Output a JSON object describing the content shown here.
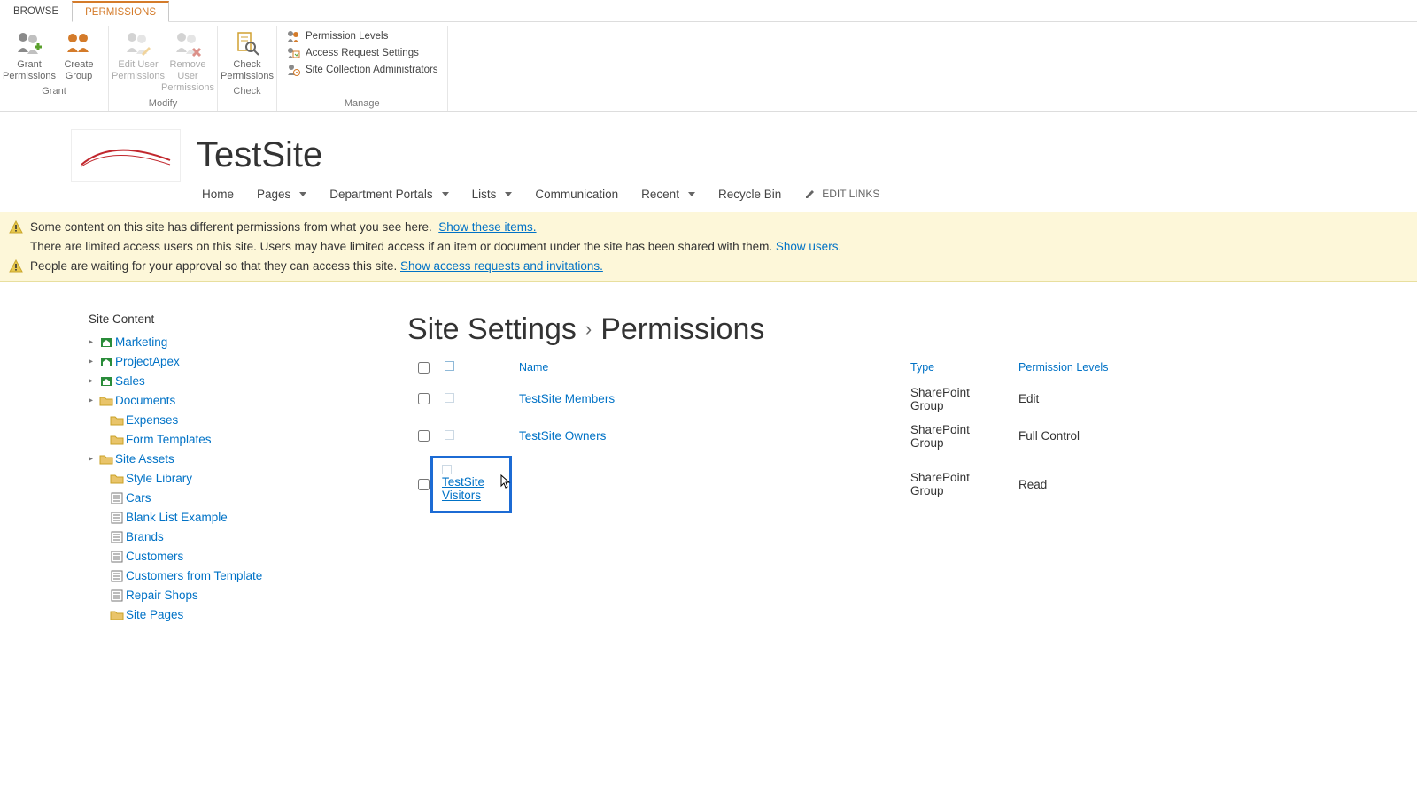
{
  "tabs": {
    "browse": "BROWSE",
    "permissions": "PERMISSIONS"
  },
  "ribbon": {
    "grant": {
      "label": "Grant",
      "grant_permissions": "Grant\nPermissions",
      "create_group": "Create\nGroup"
    },
    "modify": {
      "label": "Modify",
      "edit_user": "Edit User\nPermissions",
      "remove_user": "Remove User\nPermissions"
    },
    "check": {
      "label": "Check",
      "check_permissions": "Check\nPermissions"
    },
    "manage": {
      "label": "Manage",
      "permission_levels": "Permission Levels",
      "access_request": "Access Request Settings",
      "site_collection_admins": "Site Collection Administrators"
    }
  },
  "site": {
    "title": "TestSite"
  },
  "nav": {
    "home": "Home",
    "pages": "Pages",
    "department": "Department Portals",
    "lists": "Lists",
    "communication": "Communication",
    "recent": "Recent",
    "recycle": "Recycle Bin",
    "edit_links": "EDIT LINKS"
  },
  "notifications": {
    "diff_perms": "Some content on this site has different permissions from what you see here.",
    "show_items": "Show these items.",
    "limited_access": "There are limited access users on this site. Users may have limited access if an item or document under the site has been shared with them.",
    "show_users": "Show users.",
    "approval": "People are waiting for your approval so that they can access this site.",
    "show_requests": "Show access requests and invitations."
  },
  "tree": {
    "title": "Site Content",
    "items": [
      {
        "label": "Marketing",
        "expandable": true
      },
      {
        "label": "ProjectApex",
        "expandable": true
      },
      {
        "label": "Sales",
        "expandable": true
      },
      {
        "label": "Documents",
        "expandable": true
      },
      {
        "label": "Expenses",
        "expandable": false
      },
      {
        "label": "Form Templates",
        "expandable": false
      },
      {
        "label": "Site Assets",
        "expandable": true
      },
      {
        "label": "Style Library",
        "expandable": false
      },
      {
        "label": "Cars",
        "expandable": false
      },
      {
        "label": "Blank List Example",
        "expandable": false
      },
      {
        "label": "Brands",
        "expandable": false
      },
      {
        "label": "Customers",
        "expandable": false
      },
      {
        "label": "Customers from Template",
        "expandable": false
      },
      {
        "label": "Repair Shops",
        "expandable": false
      },
      {
        "label": "Site Pages",
        "expandable": false
      }
    ]
  },
  "breadcrumb": {
    "site_settings": "Site Settings",
    "permissions": "Permissions"
  },
  "table": {
    "headers": {
      "name": "Name",
      "type": "Type",
      "levels": "Permission Levels"
    },
    "rows": [
      {
        "name": "TestSite Members",
        "type": "SharePoint Group",
        "level": "Edit"
      },
      {
        "name": "TestSite Owners",
        "type": "SharePoint Group",
        "level": "Full Control"
      },
      {
        "name": "TestSite Visitors",
        "type": "SharePoint Group",
        "level": "Read"
      }
    ]
  }
}
